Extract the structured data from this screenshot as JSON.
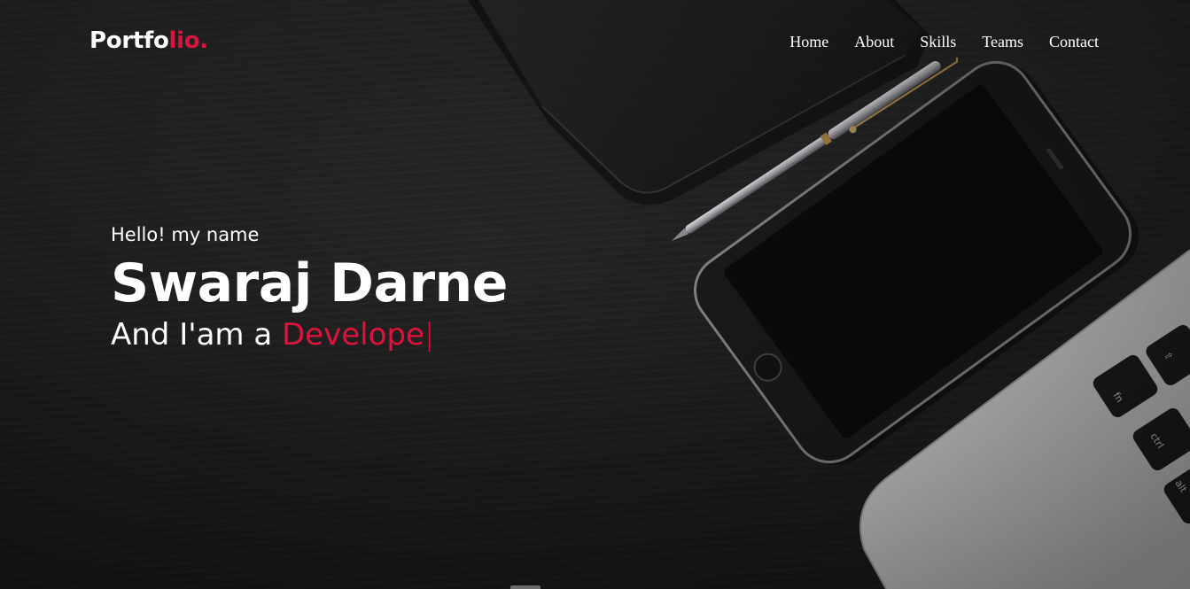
{
  "brand": {
    "logo_main": "Portfo",
    "logo_accent": "lio.",
    "accent_color": "#dc143c"
  },
  "nav": {
    "items": [
      {
        "label": "Home"
      },
      {
        "label": "About"
      },
      {
        "label": "Skills"
      },
      {
        "label": "Teams"
      },
      {
        "label": "Contact"
      }
    ]
  },
  "hero": {
    "greeting": "Hello! my name",
    "name": "Swaraj Darne",
    "role_prefix": "And I'am a ",
    "role_typed": "Develope",
    "caret": "|"
  },
  "background": {
    "description_icons": [
      "notebook-icon",
      "pen-icon",
      "smartphone-icon",
      "laptop-icon"
    ]
  }
}
